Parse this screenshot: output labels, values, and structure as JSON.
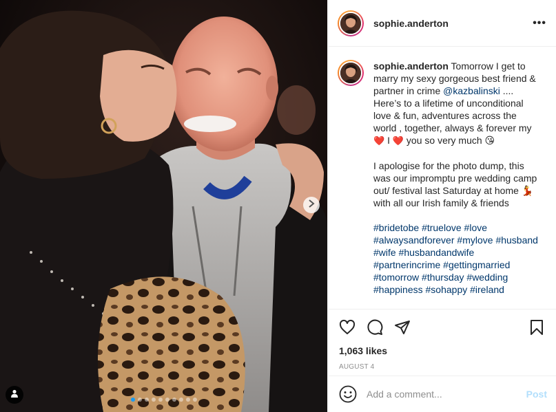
{
  "post": {
    "username": "sophie.anderton",
    "more_label": "•••",
    "caption": {
      "mention": "@kazbalinski",
      "line1": "Tomorrow I get to marry my sexy gorgeous best friend & partner in crime ",
      "line2": " .... Here’s to a lifetime of unconditional love & fun, adventures across the world , together, always & forever my ",
      "heart_1": "❤️",
      "text_i": " I ",
      "heart_2": "❤️",
      "text_after": " you so very much ",
      "emoji_kiss": "😘",
      "para2": "I apologise for the photo dump, this was our impromptu pre wedding camp out/ festival last Saturday at home ",
      "emoji_dancer": "💃",
      "para2_end": " with all our Irish family & friends"
    },
    "hashtags": [
      "#bridetobe",
      "#truelove",
      "#love",
      "#alwaysandforever",
      "#mylove",
      "#husband",
      "#wife",
      "#husbandandwife",
      "#partnerincrime",
      "#gettingmarried",
      "#tomorrow",
      "#thursday",
      "#wedding",
      "#happiness",
      "#sohappy",
      "#ireland"
    ],
    "likes": "1,063 likes",
    "date": "AUGUST 4",
    "comment_placeholder": "Add a comment...",
    "post_label": "Post"
  },
  "carousel": {
    "dot_count": 10,
    "active_index": 0
  },
  "icons": {
    "like": "heart-icon",
    "comment": "comment-icon",
    "share": "share-icon",
    "save": "bookmark-icon",
    "emoji": "emoji-icon",
    "next": "chevron-right-icon",
    "tags": "person-tag-icon"
  },
  "colors": {
    "link": "#00376b",
    "hashtag": "#00376b",
    "post_disabled": "#b2dffc",
    "active_dot": "#1c9bef",
    "muted": "#8e8e8e"
  }
}
